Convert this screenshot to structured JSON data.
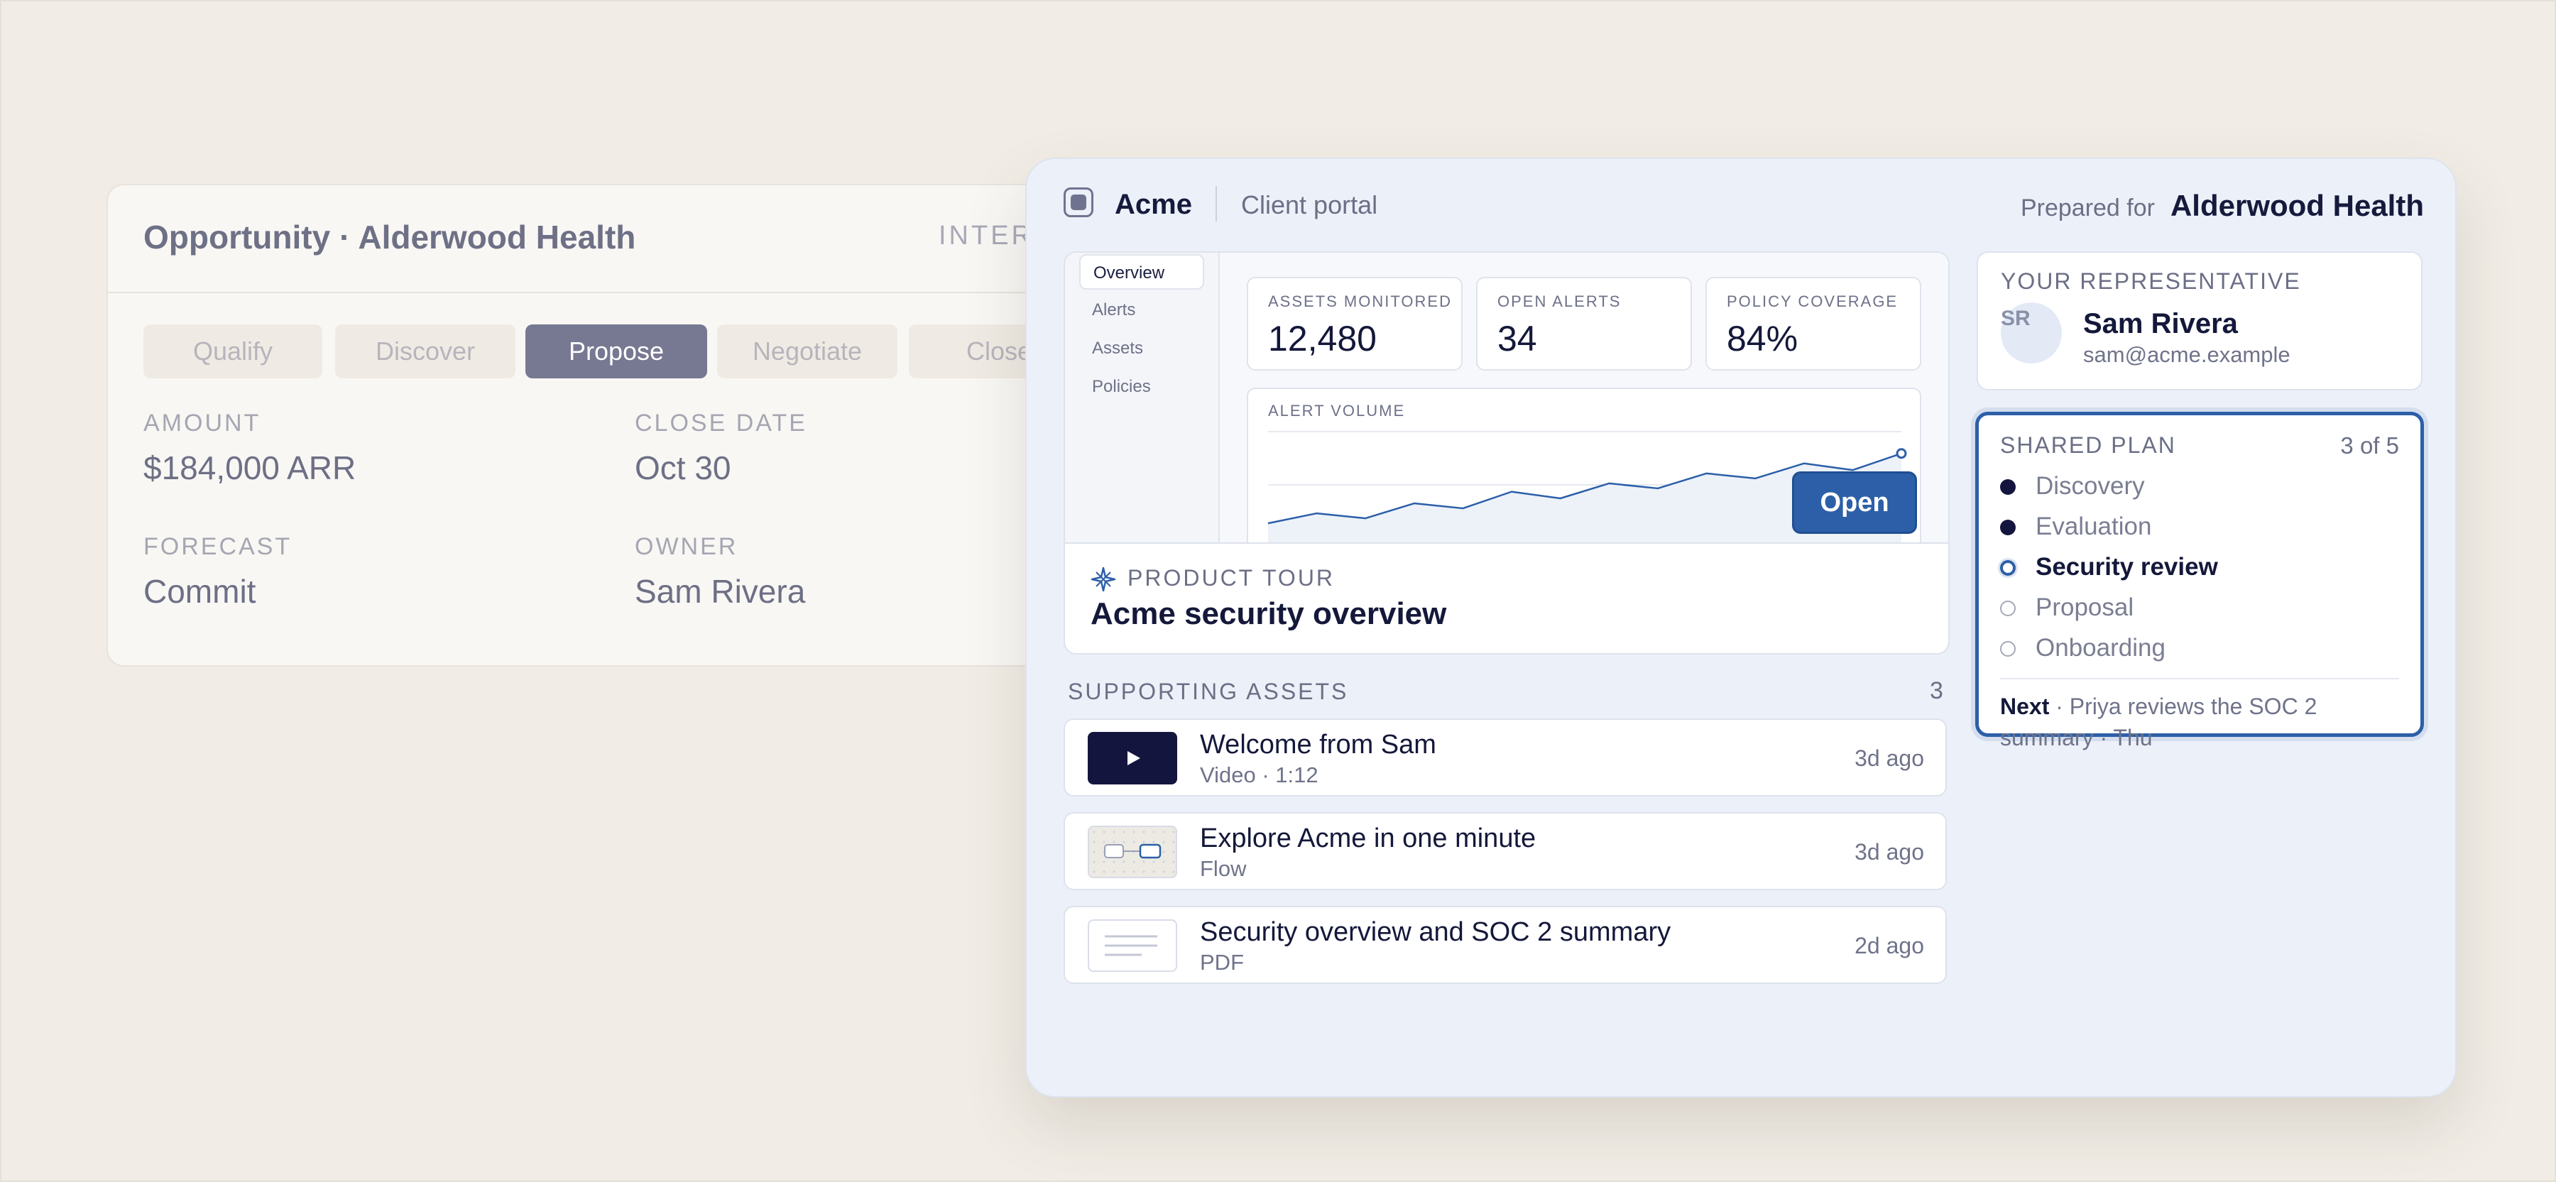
{
  "crm": {
    "title": "Opportunity · Alderwood Health",
    "tag": "INTER",
    "stages": [
      "Qualify",
      "Discover",
      "Propose",
      "Negotiate",
      "Close"
    ],
    "active_stage": "Propose",
    "fields": {
      "amount_label": "AMOUNT",
      "amount": "$184,000 ARR",
      "close_date_label": "CLOSE DATE",
      "close_date": "Oct 30",
      "forecast_label": "FORECAST",
      "forecast": "Commit",
      "owner_label": "OWNER",
      "owner": "Sam Rivera"
    }
  },
  "portal": {
    "brand": "Acme",
    "subtitle": "Client portal",
    "prepared_label": "Prepared for",
    "prepared_client": "Alderwood Health",
    "preview": {
      "nav": [
        "Overview",
        "Alerts",
        "Assets",
        "Policies"
      ],
      "active_nav": "Overview",
      "kpis": [
        {
          "label": "ASSETS MONITORED",
          "value": "12,480"
        },
        {
          "label": "OPEN ALERTS",
          "value": "34"
        },
        {
          "label": "POLICY COVERAGE",
          "value": "84%"
        }
      ],
      "chart_label": "ALERT VOLUME"
    },
    "tour": {
      "kicker": "PRODUCT TOUR",
      "title": "Acme security overview",
      "button": "Open"
    },
    "assets": {
      "heading": "SUPPORTING ASSETS",
      "count": "3",
      "items": [
        {
          "title": "Welcome from Sam",
          "meta": "Video · 1:12",
          "age": "3d ago",
          "thumb": "video-thumbnail"
        },
        {
          "title": "Explore Acme in one minute",
          "meta": "Flow",
          "age": "3d ago",
          "thumb": "flow-thumbnail"
        },
        {
          "title": "Security overview and SOC 2 summary",
          "meta": "PDF",
          "age": "2d ago",
          "thumb": "document-thumbnail"
        }
      ]
    },
    "representative": {
      "kicker": "YOUR REPRESENTATIVE",
      "initials": "SR",
      "name": "Sam Rivera",
      "email": "sam@acme.example"
    },
    "plan": {
      "kicker": "SHARED PLAN",
      "progress": "3 of 5",
      "steps": [
        {
          "label": "Discovery",
          "status": "done"
        },
        {
          "label": "Evaluation",
          "status": "done"
        },
        {
          "label": "Security review",
          "status": "current"
        },
        {
          "label": "Proposal",
          "status": "pending"
        },
        {
          "label": "Onboarding",
          "status": "pending"
        }
      ],
      "next_label": "Next",
      "next_text": " · Priya reviews the SOC 2 summary · Thu"
    }
  },
  "colors": {
    "accent": "#2c5fa8",
    "navy": "#14153f",
    "background": "#f1ede6",
    "portal_bg": "#ecf0f8",
    "stage_active": "#777891"
  },
  "icons": {
    "logo": "square-logo-icon",
    "tour": "sparkle-icon",
    "video": "play-icon"
  },
  "chart_data": {
    "type": "area",
    "title": "ALERT VOLUME",
    "x": [
      1,
      2,
      3,
      4,
      5,
      6,
      7,
      8,
      9,
      10,
      11,
      12,
      13,
      14
    ],
    "values": [
      20,
      26,
      23,
      32,
      29,
      39,
      35,
      44,
      41,
      50,
      47,
      56,
      52,
      62
    ],
    "ylim": [
      0,
      70
    ],
    "grid": true,
    "legend": "none"
  }
}
